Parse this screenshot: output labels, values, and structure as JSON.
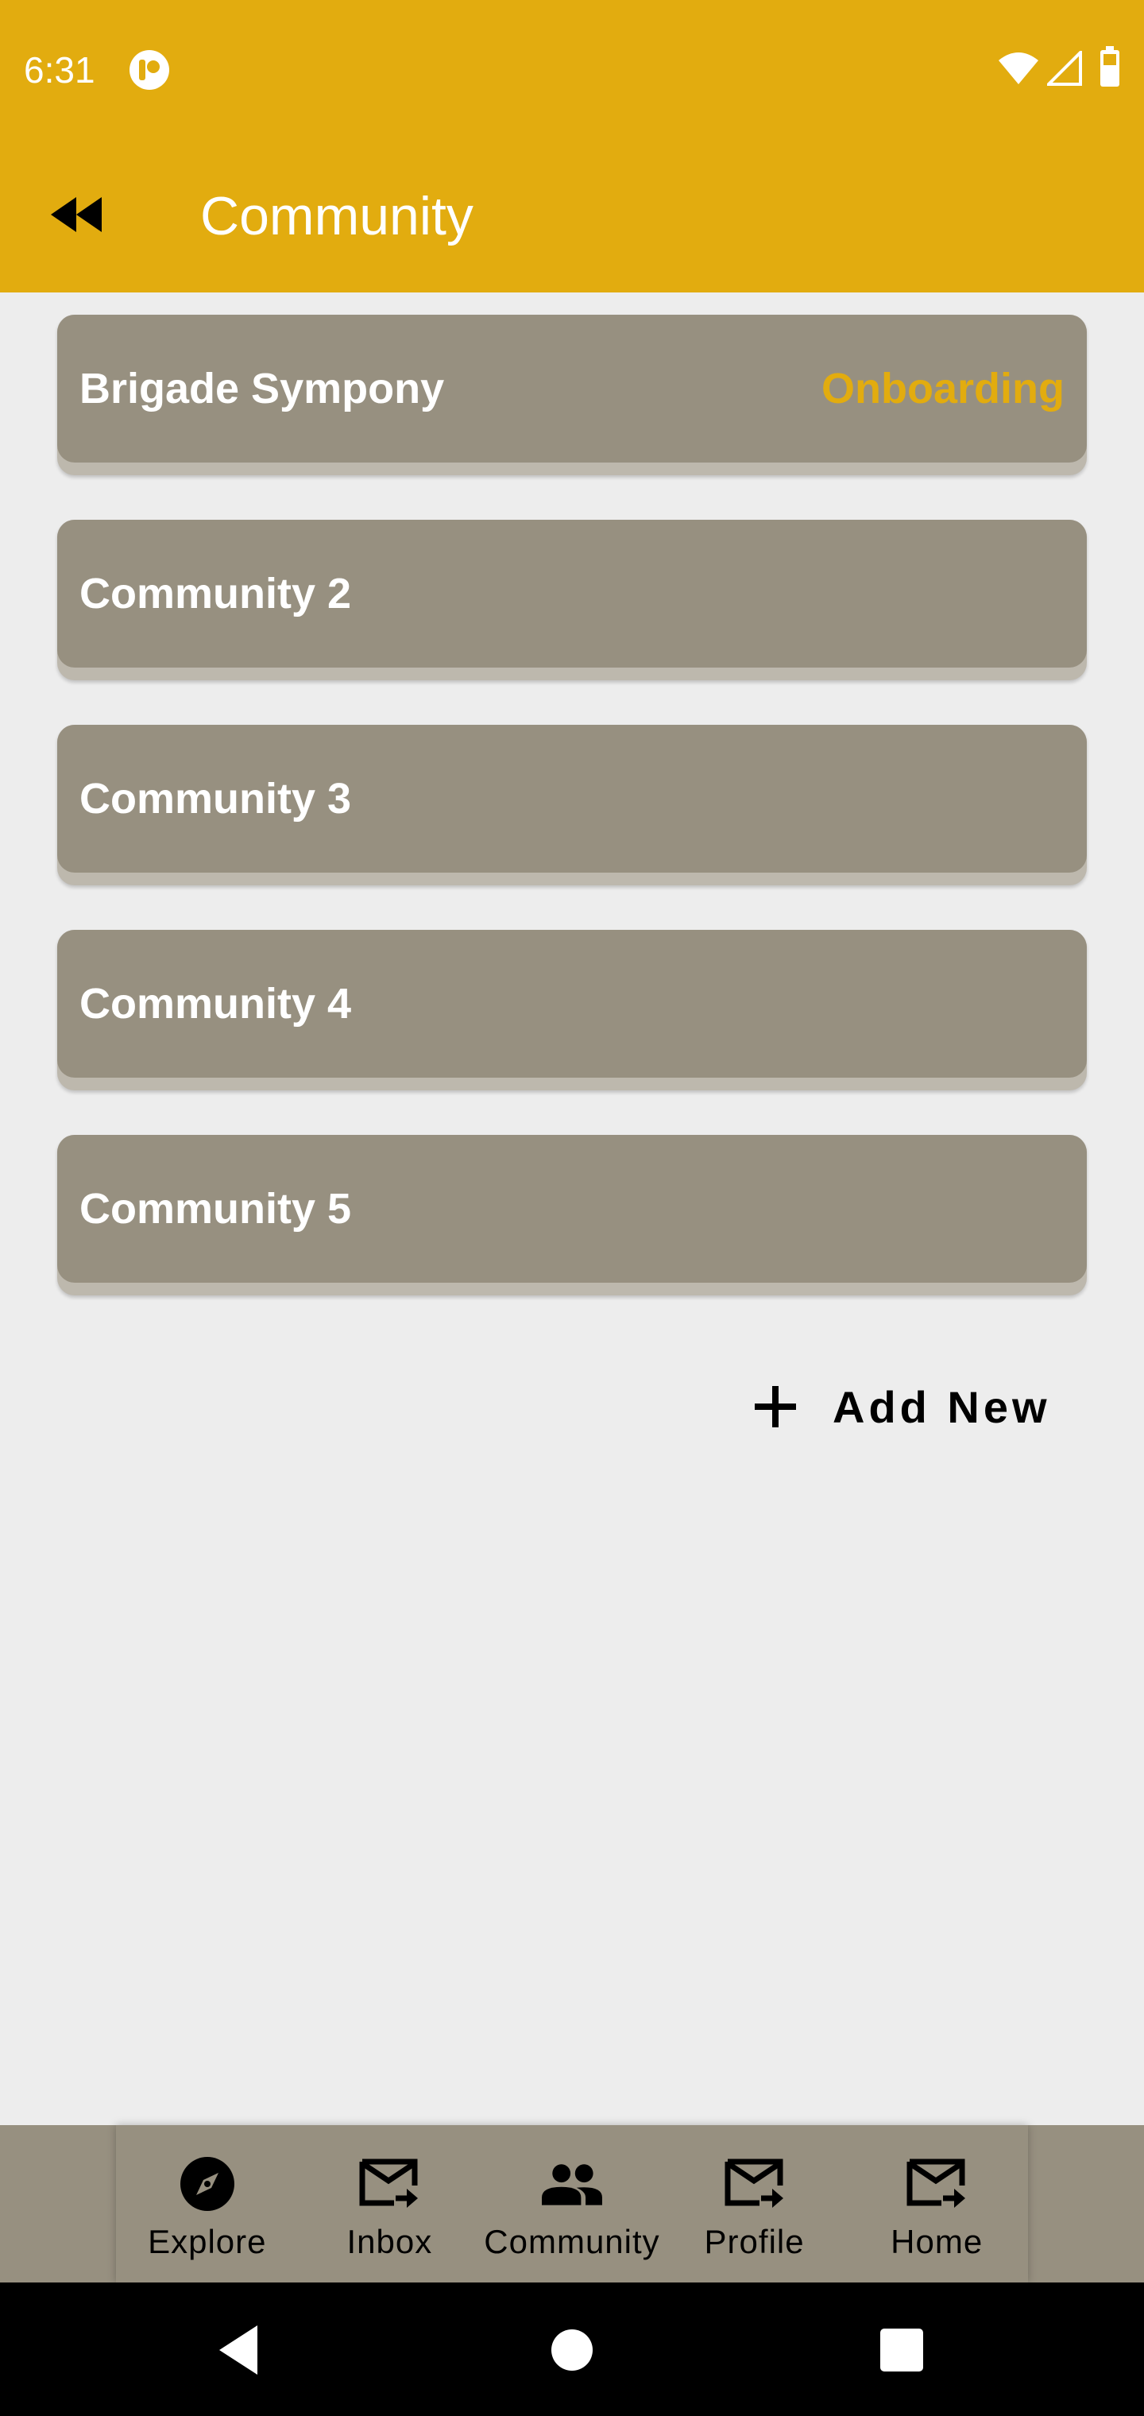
{
  "status_bar": {
    "time": "6:31",
    "icons": [
      "app-notification-icon",
      "wifi-icon",
      "signal-icon",
      "battery-icon"
    ]
  },
  "header": {
    "back_icon": "rewind-icon",
    "title": "Community"
  },
  "communities": [
    {
      "name": "Brigade Sympony",
      "status": "Onboarding"
    },
    {
      "name": "Community 2",
      "status": ""
    },
    {
      "name": "Community 3",
      "status": ""
    },
    {
      "name": "Community 4",
      "status": ""
    },
    {
      "name": "Community 5",
      "status": ""
    }
  ],
  "add_new": {
    "icon": "plus-icon",
    "label": "Add New"
  },
  "bottom_nav": [
    {
      "label": "Explore",
      "icon": "compass-icon"
    },
    {
      "label": "Inbox",
      "icon": "mail-forward-icon"
    },
    {
      "label": "Community",
      "icon": "people-icon"
    },
    {
      "label": "Profile",
      "icon": "mail-forward-icon"
    },
    {
      "label": "Home",
      "icon": "mail-forward-icon"
    }
  ],
  "system_nav": [
    "back-triangle-icon",
    "home-circle-icon",
    "recents-square-icon"
  ],
  "colors": {
    "accent": "#e2ac0f",
    "card": "#979080",
    "background": "#ededed",
    "text_on_card": "#ffffff"
  }
}
